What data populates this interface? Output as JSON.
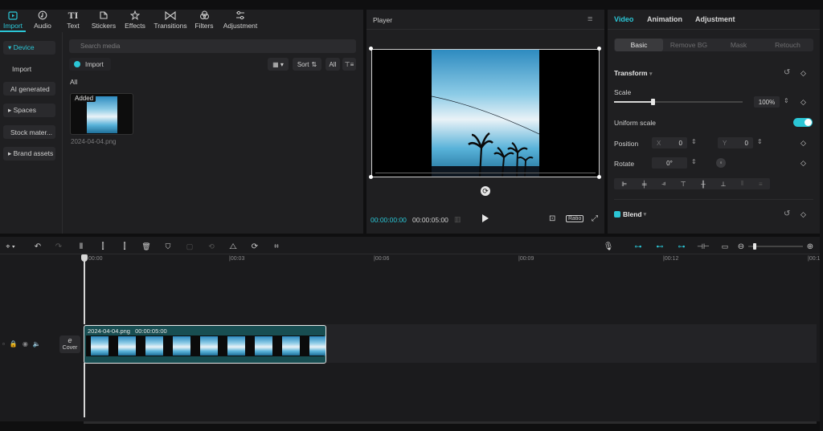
{
  "toolbar": {
    "tabs": [
      {
        "label": "Import",
        "icon": "import-icon",
        "active": true
      },
      {
        "label": "Audio",
        "icon": "audio-icon"
      },
      {
        "label": "Text",
        "icon": "text-icon"
      },
      {
        "label": "Stickers",
        "icon": "stickers-icon"
      },
      {
        "label": "Effects",
        "icon": "effects-icon"
      },
      {
        "label": "Transitions",
        "icon": "transitions-icon"
      },
      {
        "label": "Filters",
        "icon": "filters-icon"
      },
      {
        "label": "Adjustment",
        "icon": "adjustment-icon"
      }
    ]
  },
  "sidebar": {
    "items": [
      {
        "label": "▾ Device",
        "active": true
      },
      {
        "label": "Import"
      },
      {
        "label": "AI generated"
      },
      {
        "label": "▸ Spaces"
      },
      {
        "label": "Stock mater..."
      },
      {
        "label": "▸ Brand assets"
      }
    ]
  },
  "media": {
    "search_placeholder": "Search media",
    "import_label": "Import",
    "sort_label": "Sort",
    "all_filter_label": "All",
    "section_label": "All",
    "item": {
      "badge": "Added",
      "filename": "2024-04-04.png"
    }
  },
  "player": {
    "title": "Player",
    "current_time": "00:00:00:00",
    "total_time": "00:00:05:00",
    "ratio_label": "Ratio"
  },
  "inspector": {
    "tabs": [
      "Video",
      "Animation",
      "Adjustment"
    ],
    "subtabs": [
      "Basic",
      "Remove BG",
      "Mask",
      "Retouch"
    ],
    "transform_label": "Transform",
    "scale_label": "Scale",
    "scale_value": "100%",
    "scale_fraction": 0.3,
    "uniform_scale_label": "Uniform scale",
    "uniform_scale_on": true,
    "position_label": "Position",
    "pos_x_label": "X",
    "pos_x": "0",
    "pos_y_label": "Y",
    "pos_y": "0",
    "rotate_label": "Rotate",
    "rotate_value": "0°",
    "blend_label": "Blend",
    "accent": "#2bc6d6"
  },
  "timeline": {
    "ruler": [
      "00:00",
      "|00:03",
      "|00:06",
      "|00:09",
      "|00:12",
      "|00:1"
    ],
    "clip": {
      "name": "2024-04-04.png",
      "duration": "00:00:05:00"
    },
    "cover_label": "Cover"
  }
}
